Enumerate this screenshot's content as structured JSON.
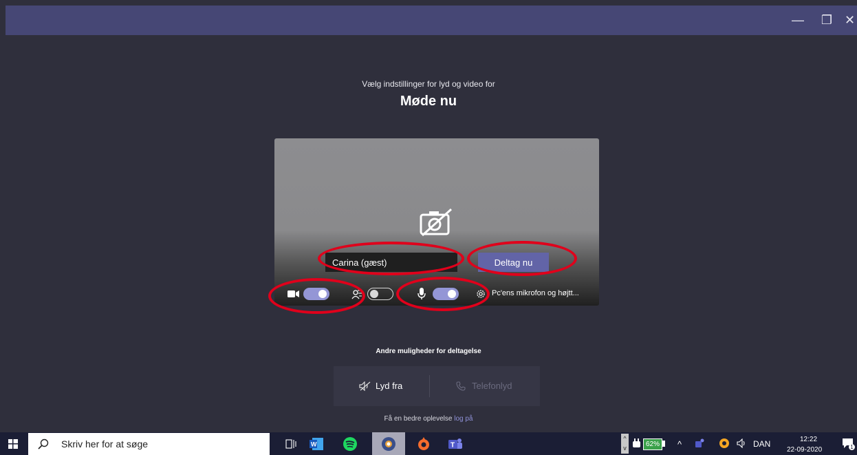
{
  "window": {
    "minimize_glyph": "—",
    "maximize_glyph": "❐",
    "close_glyph": "✕"
  },
  "prejoin": {
    "subtitle": "Vælg indstillinger for lyd og video for",
    "meeting_title": "Møde nu",
    "name_value": "Carina (gæst)",
    "join_label": "Deltag nu",
    "camera_on": true,
    "blur_on": false,
    "mic_on": true,
    "device_label": "Pc'ens mikrofon og højtt..."
  },
  "other_options": {
    "title": "Andre muligheder for deltagelse",
    "audio_off_label": "Lyd fra",
    "phone_audio_label": "Telefonlyd",
    "better_text": "Få en bedre oplevelse",
    "login_link": "log på"
  },
  "taskbar": {
    "search_placeholder": "Skriv her for at søge",
    "battery": "62%",
    "language": "DAN",
    "time": "12:22",
    "date": "22-09-2020",
    "notification_count": "1",
    "apps": [
      "task-view-icon",
      "word-icon",
      "spotify-icon",
      "app-icon",
      "origin-icon",
      "teams-icon"
    ]
  },
  "colors": {
    "accent": "#6264a7",
    "toggle_on": "#9496d6",
    "annotation": "#e0001b",
    "title_bar": "#464775",
    "background": "#2f2f3c"
  }
}
